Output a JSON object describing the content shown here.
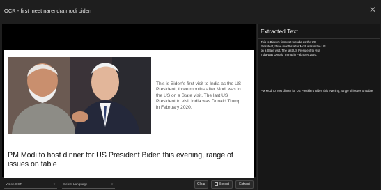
{
  "window": {
    "title": "OCR - first meet narendra modi biden",
    "close_icon": "close-icon"
  },
  "preview": {
    "article_summary": "This is Biden's first visit to India as the US President, three months after Modi was in the US on a State visit. The last US President to visit India was Donald Trump in February 2020.",
    "headline": "PM Modi to host dinner for US President Biden this evening, range of issues on table"
  },
  "panel": {
    "heading": "Extracted Text",
    "paragraphs": [
      "This is Biden's first visit to India as the US President, three months after Modi was in the US on a State visit. The last US President to visit India was Donald Trump in February 2020.",
      "PM Modi to host dinner for US President Biden this evening, range of issues on table"
    ]
  },
  "toolbar": {
    "engine_select": "Vision OCR",
    "language_placeholder": "Select Language",
    "clear_label": "Clear",
    "select_label": "Select",
    "extract_label": "Extract"
  },
  "colors": {
    "background": "#1e1e1e",
    "panel": "#171717",
    "preview": "#000000"
  }
}
